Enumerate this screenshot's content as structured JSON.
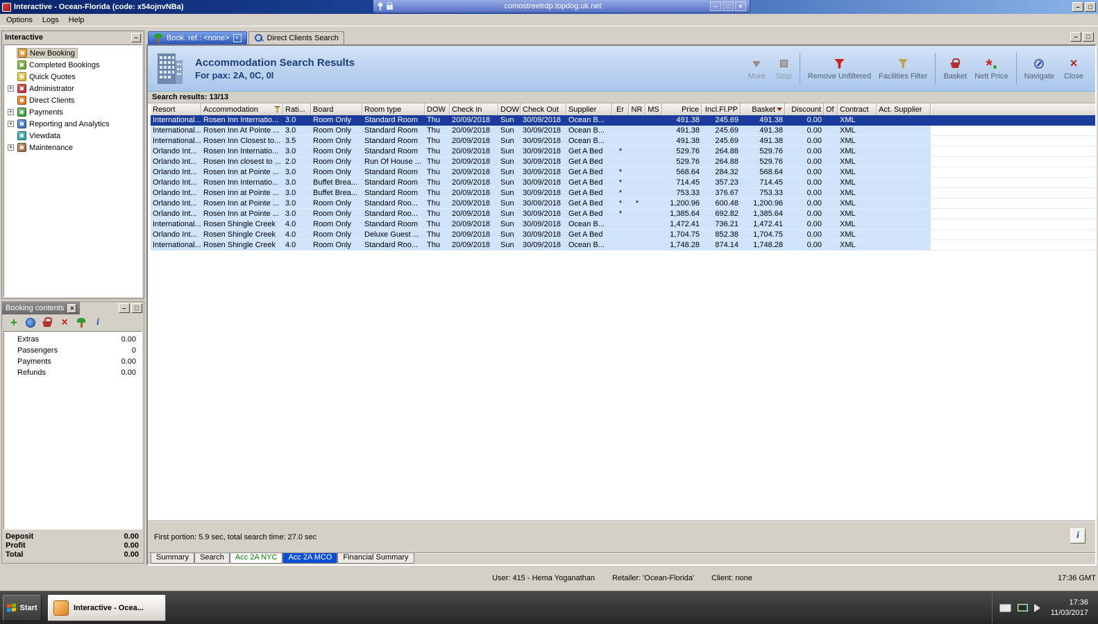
{
  "window": {
    "title": "Interactive - Ocean-Florida (code: x54ojnvNBa)",
    "rdp_address": "comostreetrdp.topdog.uk.net",
    "menu": [
      {
        "label": "Options"
      },
      {
        "label": "Logs"
      },
      {
        "label": "Help"
      }
    ]
  },
  "colors": {
    "selection_row": "#1b3c9c",
    "result_row": "#cfe3fb",
    "active_view_tab": "#0a4fd6",
    "nyc_tab_text": "#007700",
    "header_gradient_top": "#d3e2f6"
  },
  "sidebar": {
    "title": "Interactive",
    "items": [
      {
        "label": "New Booking",
        "icon": "booking",
        "selected": true
      },
      {
        "label": "Completed Bookings",
        "icon": "completed"
      },
      {
        "label": "Quick Quotes",
        "icon": "quotes"
      },
      {
        "label": "Administrator",
        "icon": "admin",
        "expander": "+"
      },
      {
        "label": "Direct Clients",
        "icon": "clients"
      },
      {
        "label": "Payments",
        "icon": "payments",
        "expander": "+"
      },
      {
        "label": "Reporting and Analytics",
        "icon": "reporting",
        "expander": "+"
      },
      {
        "label": "Viewdata",
        "icon": "viewdata"
      },
      {
        "label": "Maintenance",
        "icon": "maintenance",
        "expander": "+"
      }
    ]
  },
  "booking_contents": {
    "title": "Booking contents",
    "toolbar_icons": [
      "add",
      "world",
      "basket",
      "delete",
      "palm",
      "info"
    ],
    "rows": [
      {
        "label": "Extras",
        "value": "0.00"
      },
      {
        "label": "Passengers",
        "value": "0"
      },
      {
        "label": "Payments",
        "value": "0.00"
      },
      {
        "label": "Refunds",
        "value": "0.00"
      }
    ],
    "totals": [
      {
        "label": "Deposit",
        "value": "0.00"
      },
      {
        "label": "Profit",
        "value": "0.00"
      },
      {
        "label": "Total",
        "value": "0.00"
      }
    ]
  },
  "main": {
    "doc_tabs": [
      {
        "label": "Book. ref.: <none>",
        "icon": "palm",
        "active": true,
        "closable": true
      },
      {
        "label": "Direct Clients Search",
        "icon": "search-person"
      }
    ],
    "header": {
      "title": "Accommodation Search Results",
      "subtitle": "For pax: 2A, 0C, 0I"
    },
    "toolbar": [
      {
        "label": "More",
        "icon": "more",
        "disabled": true
      },
      {
        "label": "Stop",
        "icon": "stop",
        "disabled": true,
        "sep_after": true
      },
      {
        "label": "Remove Unfiltered",
        "icon": "funnel-red"
      },
      {
        "label": "Facilities Filter",
        "icon": "funnel-q",
        "sep_after": true
      },
      {
        "label": "Basket",
        "icon": "basket"
      },
      {
        "label": "Nett Price",
        "icon": "nett",
        "sep_after": true
      },
      {
        "label": "Navigate",
        "icon": "navigate"
      },
      {
        "label": "Close",
        "icon": "close-red"
      }
    ],
    "results_label": "Search results: 13/13",
    "footer_status": "First portion: 5.9 sec, total search time: 27.0 sec",
    "bottom_tabs": [
      {
        "label": "Summary"
      },
      {
        "label": "Search"
      },
      {
        "label": "Acc 2A NYC",
        "green": true
      },
      {
        "label": "Acc 2A MCO",
        "active": true
      },
      {
        "label": "Financial Summary"
      }
    ]
  },
  "table": {
    "columns": [
      "Resort",
      "Accommodation",
      "Rati...",
      "Board",
      "Room type",
      "DOW",
      "Check In",
      "DOW",
      "Check Out",
      "Supplier",
      "Er",
      "NR",
      "MS",
      "Price",
      "Incl.Fl.PP",
      "Basket",
      "Discount",
      "Of",
      "Contract",
      "Act. Supplier"
    ],
    "selected_row": 0,
    "rows": [
      [
        "International...",
        "Rosen Inn Internatio...",
        "3.0",
        "Room Only",
        "Standard Room",
        "Thu",
        "20/09/2018",
        "Sun",
        "30/09/2018",
        "Ocean B...",
        "",
        "",
        "",
        "491.38",
        "245.69",
        "491.38",
        "0.00",
        "",
        "XML",
        ""
      ],
      [
        "International...",
        "Rosen Inn At Pointe ...",
        "3.0",
        "Room Only",
        "Standard Room",
        "Thu",
        "20/09/2018",
        "Sun",
        "30/09/2018",
        "Ocean B...",
        "",
        "",
        "",
        "491.38",
        "245.69",
        "491.38",
        "0.00",
        "",
        "XML",
        ""
      ],
      [
        "International...",
        "Rosen Inn Closest to...",
        "3.5",
        "Room Only",
        "Standard Room",
        "Thu",
        "20/09/2018",
        "Sun",
        "30/09/2018",
        "Ocean B...",
        "",
        "",
        "",
        "491.38",
        "245.69",
        "491.38",
        "0.00",
        "",
        "XML",
        ""
      ],
      [
        "Orlando Int...",
        "Rosen Inn Internatio...",
        "3.0",
        "Room Only",
        "Standard Room",
        "Thu",
        "20/09/2018",
        "Sun",
        "30/09/2018",
        "Get A Bed",
        "*",
        "",
        "",
        "529.76",
        "264.88",
        "529.76",
        "0.00",
        "",
        "XML",
        ""
      ],
      [
        "Orlando Int...",
        "Rosen Inn closest to ...",
        "2.0",
        "Room Only",
        "Run Of House ...",
        "Thu",
        "20/09/2018",
        "Sun",
        "30/09/2018",
        "Get A Bed",
        "",
        "",
        "",
        "529.76",
        "264.88",
        "529.76",
        "0.00",
        "",
        "XML",
        ""
      ],
      [
        "Orlando Int...",
        "Rosen Inn at Pointe ...",
        "3.0",
        "Room Only",
        "Standard Room",
        "Thu",
        "20/09/2018",
        "Sun",
        "30/09/2018",
        "Get A Bed",
        "*",
        "",
        "",
        "568.64",
        "284.32",
        "568.64",
        "0.00",
        "",
        "XML",
        ""
      ],
      [
        "Orlando Int...",
        "Rosen Inn Internatio...",
        "3.0",
        "Buffet Brea...",
        "Standard Room",
        "Thu",
        "20/09/2018",
        "Sun",
        "30/09/2018",
        "Get A Bed",
        "*",
        "",
        "",
        "714.45",
        "357.23",
        "714.45",
        "0.00",
        "",
        "XML",
        ""
      ],
      [
        "Orlando Int...",
        "Rosen Inn at Pointe ...",
        "3.0",
        "Buffet Brea...",
        "Standard Room",
        "Thu",
        "20/09/2018",
        "Sun",
        "30/09/2018",
        "Get A Bed",
        "*",
        "",
        "",
        "753.33",
        "376.67",
        "753.33",
        "0.00",
        "",
        "XML",
        ""
      ],
      [
        "Orlando Int...",
        "Rosen Inn at Pointe ...",
        "3.0",
        "Room Only",
        "Standard Roo...",
        "Thu",
        "20/09/2018",
        "Sun",
        "30/09/2018",
        "Get A Bed",
        "*",
        "*",
        "",
        "1,200.96",
        "600.48",
        "1,200.96",
        "0.00",
        "",
        "XML",
        ""
      ],
      [
        "Orlando Int...",
        "Rosen Inn at Pointe ...",
        "3.0",
        "Room Only",
        "Standard Roo...",
        "Thu",
        "20/09/2018",
        "Sun",
        "30/09/2018",
        "Get A Bed",
        "*",
        "",
        "",
        "1,385.64",
        "692.82",
        "1,385.64",
        "0.00",
        "",
        "XML",
        ""
      ],
      [
        "International...",
        "Rosen Shingle Creek",
        "4.0",
        "Room Only",
        "Standard Room",
        "Thu",
        "20/09/2018",
        "Sun",
        "30/09/2018",
        "Ocean B...",
        "",
        "",
        "",
        "1,472.41",
        "736.21",
        "1,472.41",
        "0.00",
        "",
        "XML",
        ""
      ],
      [
        "Orlando Int...",
        "Rosen Shingle Creek",
        "4.0",
        "Room Only",
        "Deluxe Guest ...",
        "Thu",
        "20/09/2018",
        "Sun",
        "30/09/2018",
        "Get A Bed",
        "",
        "",
        "",
        "1,704.75",
        "852.38",
        "1,704.75",
        "0.00",
        "",
        "XML",
        ""
      ],
      [
        "International...",
        "Rosen Shingle Creek",
        "4.0",
        "Room Only",
        "Standard Roo...",
        "Thu",
        "20/09/2018",
        "Sun",
        "30/09/2018",
        "Ocean B...",
        "",
        "",
        "",
        "1,748.28",
        "874.14",
        "1,748.28",
        "0.00",
        "",
        "XML",
        ""
      ]
    ]
  },
  "status_bar": {
    "user": "User: 415 - Hema Yoganathan",
    "retailer": "Retailer: 'Ocean-Florida'",
    "client": "Client: none",
    "time": "17:36 GMT"
  },
  "taskbar": {
    "start_label": "Start",
    "task_label": "Interactive - Ocea...",
    "clock_time": "17:36",
    "clock_date": "11/03/2017"
  }
}
